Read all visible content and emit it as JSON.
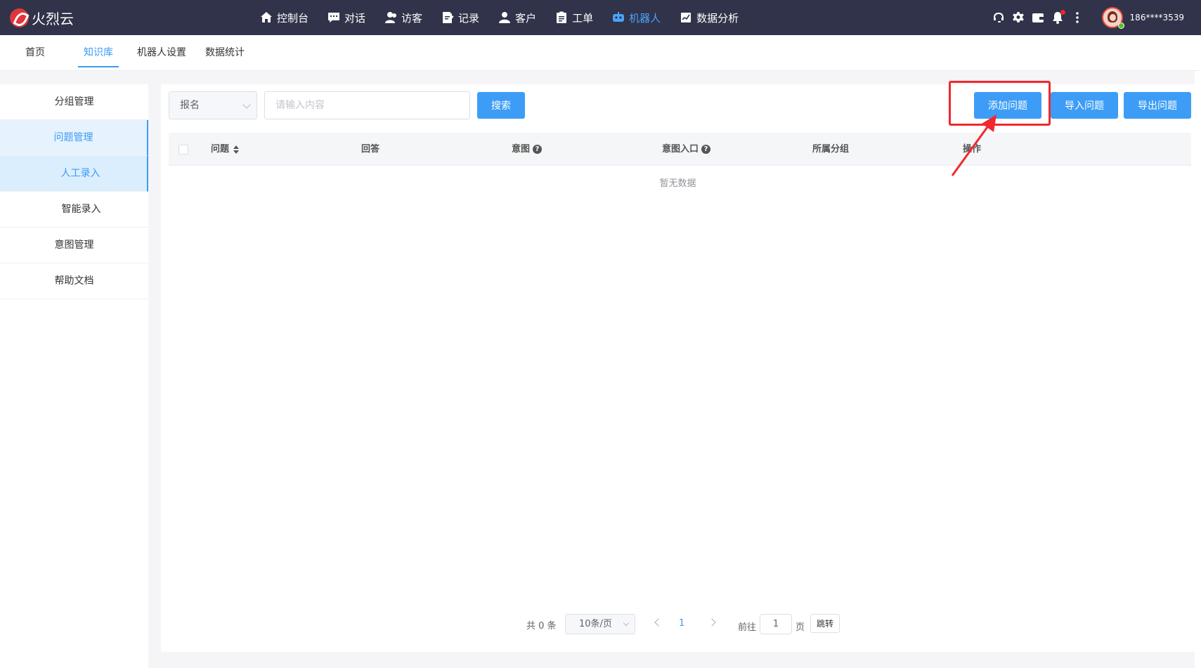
{
  "app": {
    "logo_text": "火烈云"
  },
  "nav": {
    "items": [
      {
        "label": "控制台",
        "icon": "home-icon"
      },
      {
        "label": "对话",
        "icon": "chat-icon"
      },
      {
        "label": "访客",
        "icon": "visitor-icon"
      },
      {
        "label": "记录",
        "icon": "record-icon"
      },
      {
        "label": "客户",
        "icon": "customer-icon"
      },
      {
        "label": "工单",
        "icon": "ticket-icon"
      },
      {
        "label": "机器人",
        "icon": "robot-icon",
        "active": true
      },
      {
        "label": "数据分析",
        "icon": "chart-icon"
      }
    ],
    "accent_color": "#4aa3f8"
  },
  "user": {
    "name": "186****3539"
  },
  "subtabs": [
    {
      "label": "首页"
    },
    {
      "label": "知识库",
      "active": true
    },
    {
      "label": "机器人设置"
    },
    {
      "label": "数据统计"
    }
  ],
  "sidebar": {
    "items": [
      {
        "label": "分组管理"
      },
      {
        "label": "问题管理"
      },
      {
        "label": "人工录入"
      },
      {
        "label": "智能录入"
      },
      {
        "label": "意图管理"
      },
      {
        "label": "帮助文档"
      }
    ]
  },
  "toolbar": {
    "filter_value": "报名",
    "search_placeholder": "请输入内容",
    "search_label": "搜索",
    "add_label": "添加问题",
    "import_label": "导入问题",
    "export_label": "导出问题",
    "button_color": "#3d9df6"
  },
  "table": {
    "columns": [
      "问题",
      "回答",
      "意图",
      "意图入口",
      "所属分组",
      "操作"
    ],
    "empty_text": "暂无数据"
  },
  "pagination": {
    "total_text": "共 0 条",
    "page_size": "10条/页",
    "current_page": "1",
    "goto_label": "前往",
    "goto_value": "1",
    "page_label": "页",
    "jump_label": "跳转"
  },
  "annotation": {
    "color": "#f2272d"
  }
}
